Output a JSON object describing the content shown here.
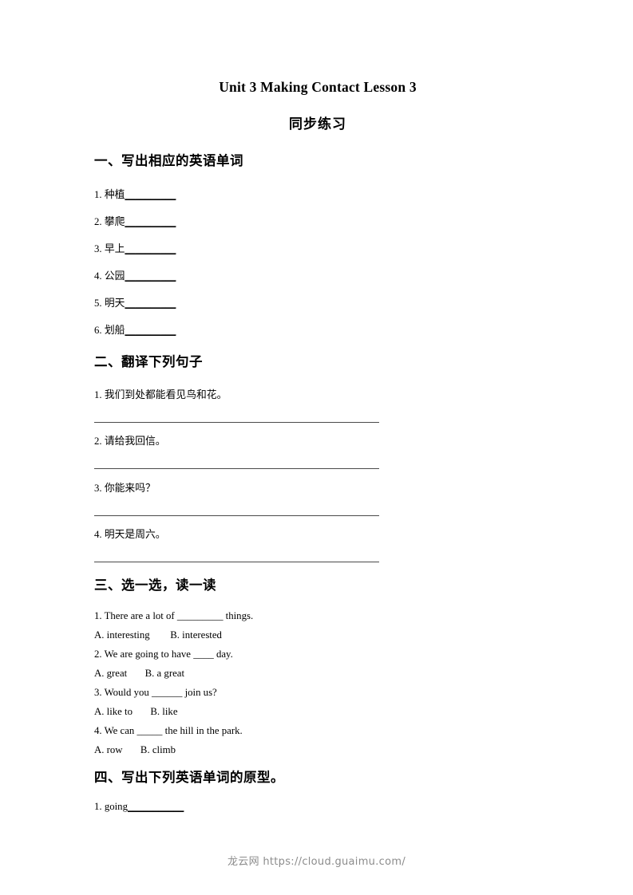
{
  "document": {
    "title": "Unit 3 Making Contact Lesson 3",
    "subtitle": "同步练习"
  },
  "sections": [
    {
      "heading": "一、写出相应的英语单词",
      "type": "fill-blank-words",
      "items": [
        {
          "number": "1.",
          "prompt": "种植",
          "blank": "__________"
        },
        {
          "number": "2.",
          "prompt": "攀爬",
          "blank": "__________"
        },
        {
          "number": "3.",
          "prompt": "早上",
          "blank": "__________"
        },
        {
          "number": "4.",
          "prompt": "公园",
          "blank": "__________"
        },
        {
          "number": "5.",
          "prompt": "明天",
          "blank": "__________"
        },
        {
          "number": "6.",
          "prompt": "划船",
          "blank": "__________"
        }
      ]
    },
    {
      "heading": "二、翻译下列句子",
      "type": "translation",
      "items": [
        {
          "number": "1.",
          "prompt": "我们到处都能看见鸟和花。"
        },
        {
          "number": "2.",
          "prompt": "请给我回信。"
        },
        {
          "number": "3.",
          "prompt": "你能来吗？"
        },
        {
          "number": "4.",
          "prompt": "明天是周六。"
        }
      ]
    },
    {
      "heading": "三、选一选，读一读",
      "type": "multiple-choice",
      "items": [
        {
          "number": "1.",
          "question": "There are a lot of _________ things.",
          "options": "A. interesting        B. interested"
        },
        {
          "number": "2.",
          "question": "We are going to have ____ day.",
          "options": "A. great       B. a great"
        },
        {
          "number": "3.",
          "question": "Would you ______ join us?",
          "options": "A. like to       B. like"
        },
        {
          "number": "4.",
          "question": "We can _____ the hill in the park.",
          "options": "A. row       B. climb"
        }
      ]
    },
    {
      "heading": "四、写出下列英语单词的原型。",
      "type": "fill-blank-words",
      "items": [
        {
          "number": "1.",
          "prompt": "going",
          "blank": "___________"
        }
      ]
    }
  ],
  "footer": {
    "watermark": "龙云网 https://cloud.guaimu.com/"
  }
}
